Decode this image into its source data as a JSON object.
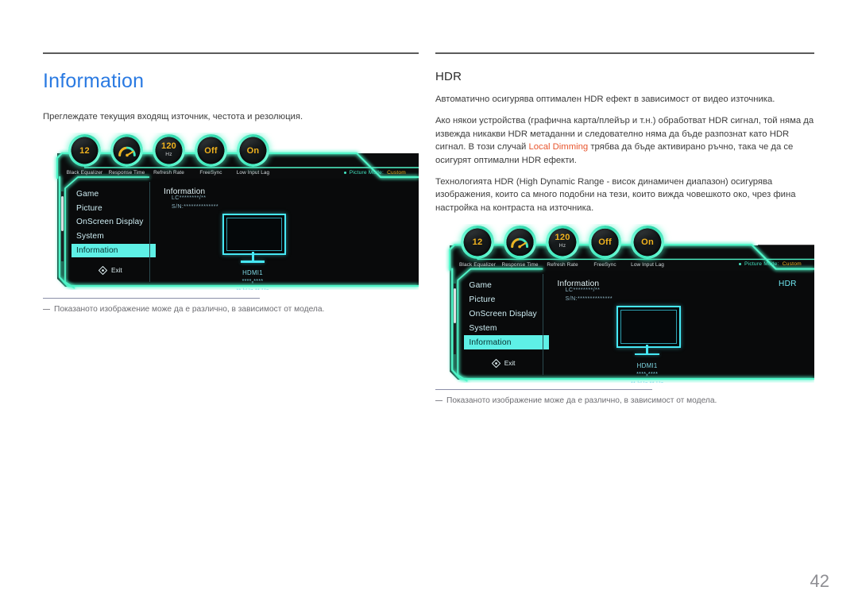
{
  "page": {
    "number": "42"
  },
  "left_column": {
    "title": "Information",
    "description": "Преглеждате текущия входящ източник, честота и резолюция.",
    "footnote": "Показаното изображение може да е различно, в зависимост от модела."
  },
  "right_column": {
    "title": "HDR",
    "paragraphs": [
      "Автоматично осигурява оптимален HDR ефект в зависимост от видео източника.",
      "Ако някои устройства (графична карта/плейър и т.н.) обработват HDR сигнал, той няма да извежда никакви HDR метаданни и следователно няма да бъде разпознат като HDR сигнал. В този случай ",
      "Технологията HDR (High Dynamic Range - висок динамичен диапазон) осигурява изображения, които са много подобни на тези, които вижда човешкото око, чрез фина настройка на контраста на източника."
    ],
    "accent_term": "Local Dimming",
    "paragraph2_rest": " трябва да бъде активирано ръчно, така че да се осигурят оптимални HDR ефекти.",
    "footnote": "Показаното изображение може да е различно, в зависимост от модела."
  },
  "osd": {
    "dials": [
      {
        "value": "12",
        "unit": "",
        "label": "Black Equalizer",
        "type": "number"
      },
      {
        "value": "",
        "unit": "",
        "label": "Response Time",
        "type": "gauge"
      },
      {
        "value": "120",
        "unit": "Hz",
        "label": "Refresh Rate",
        "type": "number"
      },
      {
        "value": "Off",
        "unit": "",
        "label": "FreeSync",
        "type": "number"
      },
      {
        "value": "On",
        "unit": "",
        "label": "Low Input Lag",
        "type": "number"
      }
    ],
    "picture_mode_label": "Picture Mode:",
    "picture_mode_value": "Custom",
    "menu_items": [
      {
        "label": "Game",
        "selected": false
      },
      {
        "label": "Picture",
        "selected": false
      },
      {
        "label": "OnScreen Display",
        "selected": false
      },
      {
        "label": "System",
        "selected": false
      },
      {
        "label": "Information",
        "selected": true
      }
    ],
    "exit_label": "Exit",
    "detail_title": "Information",
    "detail_model": "LC********/**",
    "detail_serial": "S/N:**************",
    "input_source": "HDMI1",
    "resolution": "****ₓ****",
    "frequency": "** kHz ** Hz",
    "hdr_tag": "HDR",
    "colors": {
      "accent_cyan": "#4ff5c8",
      "accent_blue": "#46e8f5",
      "value_amber": "#f0b21e",
      "panel_bg": "#090a0b",
      "highlight": "#5ef0e6"
    }
  },
  "theme": {
    "title_blue": "#2a7ae2",
    "accent_orange": "#e8552d",
    "rule_gray": "#5b5b5b",
    "body_gray": "#3c3c3c"
  }
}
